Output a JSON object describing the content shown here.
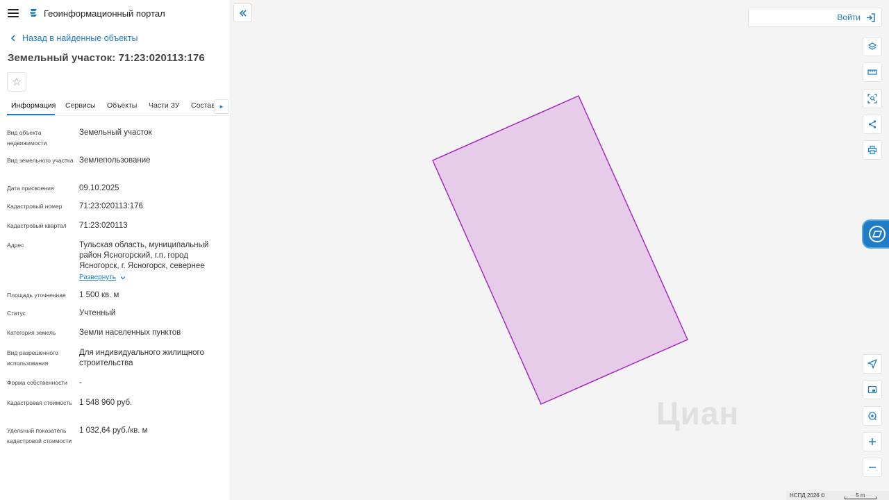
{
  "header": {
    "title": "Геоинформационный портал"
  },
  "nav": {
    "back_label": "Назад в найденные объекты"
  },
  "object": {
    "title": "Земельный участок: 71:23:020113:176"
  },
  "tabs": [
    {
      "label": "Информация"
    },
    {
      "label": "Сервисы"
    },
    {
      "label": "Объекты"
    },
    {
      "label": "Части ЗУ"
    },
    {
      "label": "Состав"
    }
  ],
  "properties": [
    {
      "label": "Вид объекта недвижимости",
      "value": "Земельный участок"
    },
    {
      "label": "Вид земельного участка",
      "value": "Землепользование"
    },
    {
      "label": "Дата присвоения",
      "value": "09.10.2025"
    },
    {
      "label": "Кадастровый номер",
      "value": "71:23:020113:176"
    },
    {
      "label": "Кадастровый квартал",
      "value": "71:23:020113"
    },
    {
      "label": "Адрес",
      "value": "Тульская область, муниципальный район Ясногорский, г.п. город Ясногорск, г. Ясногорск, севернее",
      "expand_label": "Развернуть"
    },
    {
      "label": "Площадь уточненная",
      "value": "1 500 кв. м"
    },
    {
      "label": "Статус",
      "value": "Учтенный"
    },
    {
      "label": "Категория земель",
      "value": "Земли населенных пунктов"
    },
    {
      "label": "Вид разрешенного использования",
      "value": "Для индивидуального жилищного строительства"
    },
    {
      "label": "Форма собственности",
      "value": "-"
    },
    {
      "label": "Кадастровая стоимость",
      "value": "1 548 960 руб."
    },
    {
      "label": "Удельный показатель кадастровой стоимости",
      "value": "1 032,64 руб./кв. м"
    }
  ],
  "map": {
    "login_label": "Войти",
    "copyright": "НСПД 2026 ©",
    "scale_label": "5 m",
    "watermark": "Циан",
    "parcel_fill": "#e6cce8",
    "parcel_stroke": "#a21fbf"
  },
  "colors": {
    "accent": "#1f7cc7"
  }
}
